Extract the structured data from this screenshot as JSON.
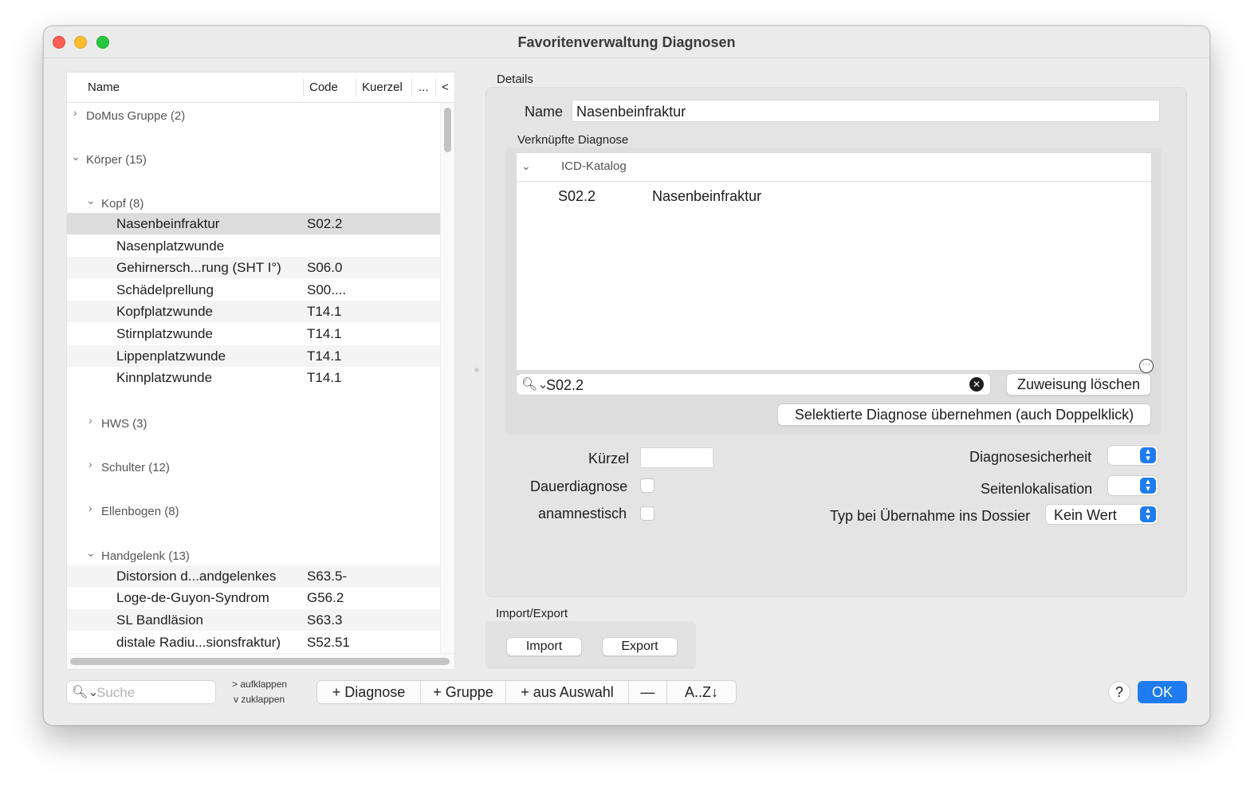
{
  "window": {
    "title": "Favoritenverwaltung Diagnosen"
  },
  "list": {
    "columns": {
      "name": "Name",
      "code": "Code",
      "kuerzel": "Kuerzel",
      "more": "...",
      "collapse": "<"
    },
    "groups": {
      "domus": "DoMus Gruppe (2)",
      "koerper": "Körper (15)",
      "kopf": "Kopf (8)",
      "hws": "HWS (3)",
      "schulter": "Schulter (12)",
      "ellenbogen": "Ellenbogen (8)",
      "handgelenk": "Handgelenk (13)"
    },
    "kopf_items": [
      {
        "name": "Nasenbeinfraktur",
        "code": "S02.2"
      },
      {
        "name": "Nasenplatzwunde",
        "code": ""
      },
      {
        "name": "Gehirnersch...rung (SHT I°)",
        "code": "S06.0"
      },
      {
        "name": "Schädelprellung",
        "code": "S00...."
      },
      {
        "name": "Kopfplatzwunde",
        "code": "T14.1"
      },
      {
        "name": "Stirnplatzwunde",
        "code": "T14.1"
      },
      {
        "name": "Lippenplatzwunde",
        "code": "T14.1"
      },
      {
        "name": "Kinnplatzwunde",
        "code": "T14.1"
      }
    ],
    "handgelenk_items": [
      {
        "name": "Distorsion d...andgelenkes",
        "code": "S63.5-"
      },
      {
        "name": "Loge-de-Guyon-Syndrom",
        "code": "G56.2"
      },
      {
        "name": "SL Bandläsion",
        "code": "S63.3"
      },
      {
        "name": "distale Radiu...sionsfraktur)",
        "code": "S52.51"
      }
    ]
  },
  "toolbar": {
    "search_placeholder": "Suche",
    "expand": "> aufklappen",
    "collapse": "v zuklappen",
    "add_diagnosis": "+ Diagnose",
    "add_group": "+ Gruppe",
    "add_from_selection": "+ aus Auswahl",
    "remove": "—",
    "sort": "A..Z↓"
  },
  "details": {
    "section": "Details",
    "name_label": "Name",
    "name_value": "Nasenbeinfraktur",
    "linked_label": "Verknüpfte Diagnose",
    "catalog_title": "ICD-Katalog",
    "catalog_row": {
      "code": "S02.2",
      "name": "Nasenbeinfraktur"
    },
    "search_value": "S02.2",
    "clear_assignment": "Zuweisung löschen",
    "apply_selected": "Selektierte Diagnose übernehmen (auch Doppelklick)",
    "kuerzel_label": "Kürzel",
    "dauer_label": "Dauerdiagnose",
    "anamnestisch_label": "anamnestisch",
    "sicherheit_label": "Diagnosesicherheit",
    "seiten_label": "Seitenlokalisation",
    "typ_label": "Typ bei Übernahme ins Dossier",
    "typ_value": "Kein Wert"
  },
  "import_export": {
    "section": "Import/Export",
    "import": "Import",
    "export": "Export"
  },
  "footer": {
    "help": "?",
    "ok": "OK"
  }
}
